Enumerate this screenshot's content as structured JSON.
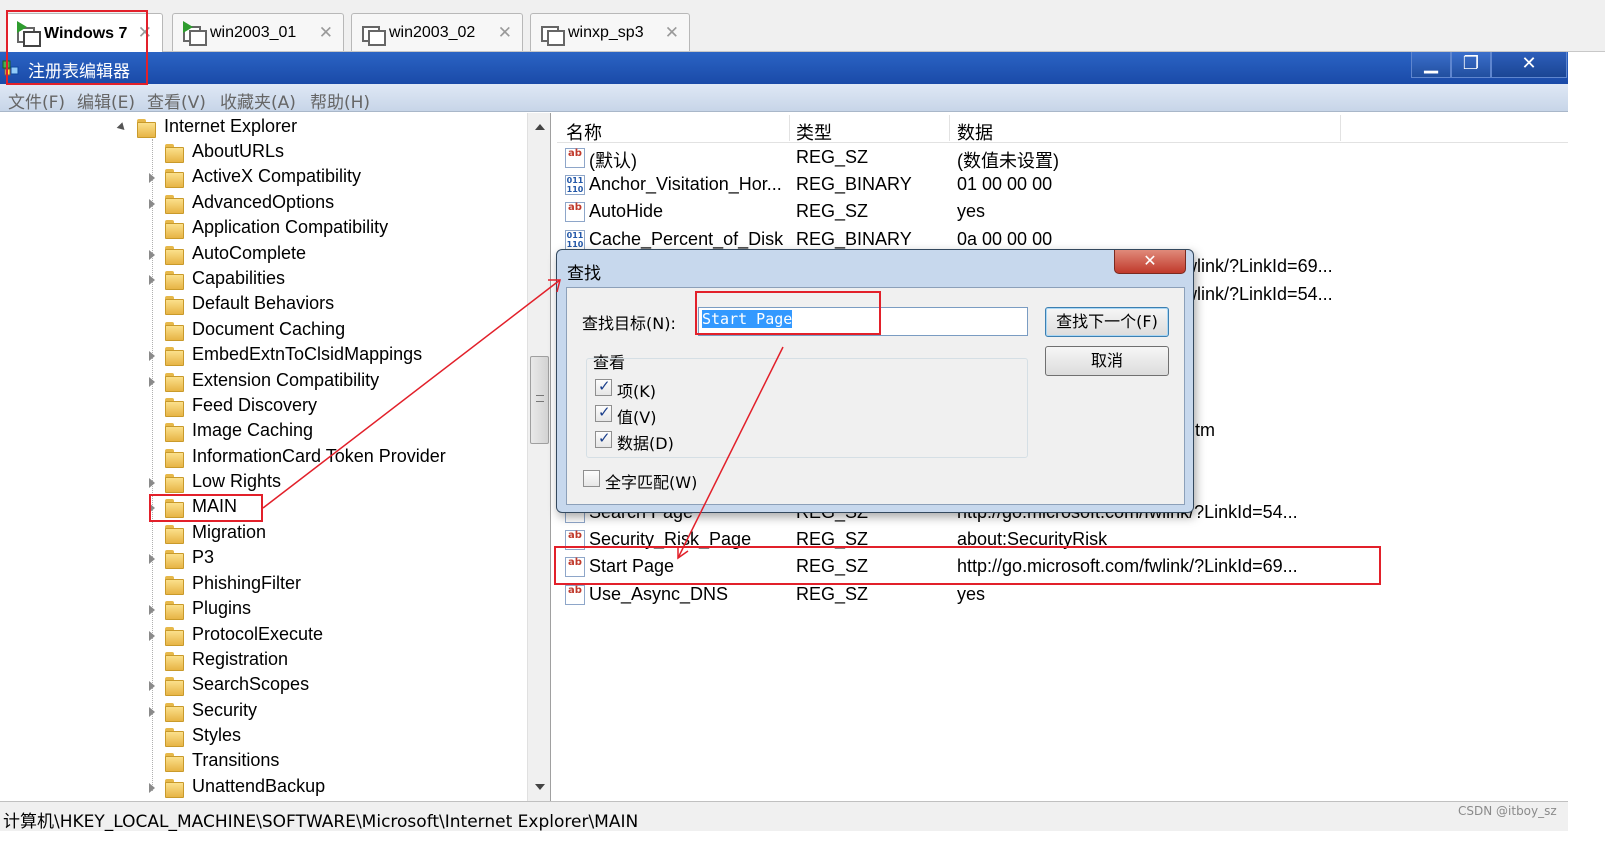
{
  "vm_tabs": [
    {
      "label": "Windows 7",
      "active": true
    },
    {
      "label": "win2003_01",
      "active": false
    },
    {
      "label": "win2003_02",
      "active": false
    },
    {
      "label": "winxp_sp3",
      "active": false
    }
  ],
  "window": {
    "title": "注册表编辑器",
    "minimize": "▁",
    "restore": "❐",
    "close": "✕"
  },
  "menu": [
    "文件(F)",
    "编辑(E)",
    "查看(V)",
    "收藏夹(A)",
    "帮助(H)"
  ],
  "tree": {
    "parent": "Internet Explorer",
    "children": [
      {
        "label": "AboutURLs",
        "expandable": false
      },
      {
        "label": "ActiveX Compatibility",
        "expandable": true
      },
      {
        "label": "AdvancedOptions",
        "expandable": true
      },
      {
        "label": "Application Compatibility",
        "expandable": false
      },
      {
        "label": "AutoComplete",
        "expandable": true
      },
      {
        "label": "Capabilities",
        "expandable": true
      },
      {
        "label": "Default Behaviors",
        "expandable": false
      },
      {
        "label": "Document Caching",
        "expandable": false
      },
      {
        "label": "EmbedExtnToClsidMappings",
        "expandable": true
      },
      {
        "label": "Extension Compatibility",
        "expandable": true
      },
      {
        "label": "Feed Discovery",
        "expandable": false
      },
      {
        "label": "Image Caching",
        "expandable": false
      },
      {
        "label": "InformationCard Token Provider",
        "expandable": false
      },
      {
        "label": "Low Rights",
        "expandable": true
      },
      {
        "label": "MAIN",
        "expandable": true
      },
      {
        "label": "Migration",
        "expandable": false
      },
      {
        "label": "P3",
        "expandable": true
      },
      {
        "label": "PhishingFilter",
        "expandable": false
      },
      {
        "label": "Plugins",
        "expandable": true
      },
      {
        "label": "ProtocolExecute",
        "expandable": true
      },
      {
        "label": "Registration",
        "expandable": false
      },
      {
        "label": "SearchScopes",
        "expandable": true
      },
      {
        "label": "Security",
        "expandable": true
      },
      {
        "label": "Styles",
        "expandable": false
      },
      {
        "label": "Transitions",
        "expandable": false
      },
      {
        "label": "UnattendBackup",
        "expandable": true
      }
    ]
  },
  "list": {
    "headers": [
      "名称",
      "类型",
      "数据"
    ],
    "rows": [
      {
        "name": "(默认)",
        "type": "REG_SZ",
        "data": "(数值未设置)",
        "icon": "ab"
      },
      {
        "name": "Anchor_Visitation_Hor...",
        "type": "REG_BINARY",
        "data": "01 00 00 00",
        "icon": "bin"
      },
      {
        "name": "AutoHide",
        "type": "REG_SZ",
        "data": "yes",
        "icon": "ab"
      },
      {
        "name": "Cache_Percent_of_Disk",
        "type": "REG_BINARY",
        "data": "0a 00 00 00",
        "icon": "bin"
      },
      {
        "name": "",
        "type": "",
        "data": "fwlink/?LinkId=69...",
        "icon": "ab"
      },
      {
        "name": "",
        "type": "",
        "data": "fwlink/?LinkId=54...",
        "icon": "ab"
      },
      {
        "name": "",
        "type": "",
        "data": "k.htm",
        "icon": "ab"
      },
      {
        "name": "Search Page",
        "type": "REG_SZ",
        "data": "http://go.microsoft.com/fwlink/?LinkId=54...",
        "icon": "ab"
      },
      {
        "name": "Security_Risk_Page",
        "type": "REG_SZ",
        "data": "about:SecurityRisk",
        "icon": "ab"
      },
      {
        "name": "Start Page",
        "type": "REG_SZ",
        "data": "http://go.microsoft.com/fwlink/?LinkId=69...",
        "icon": "ab"
      },
      {
        "name": "Use_Async_DNS",
        "type": "REG_SZ",
        "data": "yes",
        "icon": "ab"
      }
    ]
  },
  "find_dialog": {
    "title": "查找",
    "close": "✕",
    "target_label": "查找目标(N):",
    "target_value": "Start Page",
    "find_next": "查找下一个(F)",
    "cancel": "取消",
    "look_group": "查看",
    "options": [
      {
        "label": "项(K)",
        "checked": true
      },
      {
        "label": "值(V)",
        "checked": true
      },
      {
        "label": "数据(D)",
        "checked": true
      }
    ],
    "whole_match": {
      "label": "全字匹配(W)",
      "checked": false
    }
  },
  "statusbar": "计算机\\HKEY_LOCAL_MACHINE\\SOFTWARE\\Microsoft\\Internet Explorer\\MAIN",
  "watermark": "CSDN @itboy_sz",
  "annotation_color": "#e2202a"
}
